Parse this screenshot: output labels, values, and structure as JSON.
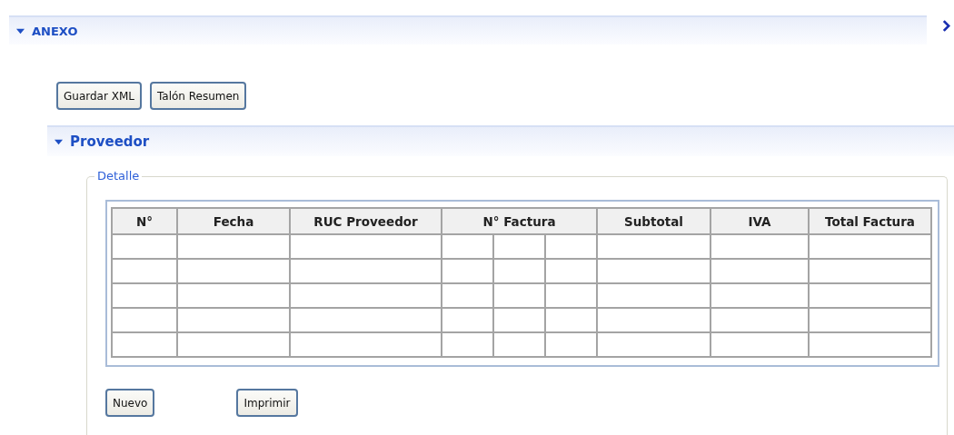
{
  "section": {
    "title": "ANEXO",
    "expanded": true
  },
  "buttons": [
    "Guardar XML",
    "Talón Resumen"
  ],
  "subsection": {
    "title": "Proveedor",
    "expanded": true
  },
  "group": {
    "legend": "Detalle"
  },
  "table": {
    "columns": [
      {
        "label": "N°",
        "kind": "plain"
      },
      {
        "label": "Fecha",
        "kind": "plain"
      },
      {
        "label": "RUC Proveedor",
        "kind": "plain"
      },
      {
        "label": "N° Factura",
        "kind": "split"
      },
      {
        "label": "Subtotal",
        "kind": "plain"
      },
      {
        "label": "IVA",
        "kind": "plain"
      },
      {
        "label": "Total Factura",
        "kind": "plain"
      }
    ]
  },
  "footer_buttons": [
    "Nuevo",
    "Imprimir"
  ]
}
